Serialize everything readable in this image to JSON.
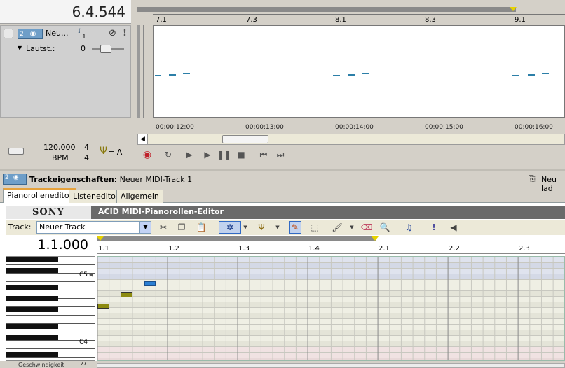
{
  "timeline": {
    "position": "6.4.544",
    "ruler_ticks": [
      "7.1",
      "7.3",
      "8.1",
      "8.3",
      "9.1"
    ],
    "time_labels": [
      "00:00:12:00",
      "00:00:13:00",
      "00:00:14:00",
      "00:00:15:00",
      "00:00:16:00"
    ]
  },
  "track": {
    "number": "2",
    "name": "Neu...",
    "midi_channel": "1",
    "volume_label": "Lautst.:",
    "volume_value": "0"
  },
  "tempo": {
    "bpm_value": "120,000",
    "bpm_label": "BPM",
    "time_sig_top": "4",
    "time_sig_bottom": "4",
    "key_label": "= A"
  },
  "properties": {
    "title_bold": "Trackeigenschaften:",
    "title_track": "Neuer MIDI-Track 1",
    "reload_label": "Neu lad"
  },
  "tabs": [
    {
      "label": "Pianorolleneditor",
      "active": true
    },
    {
      "label": "Listeneditor",
      "active": false
    },
    {
      "label": "Allgemein",
      "active": false
    }
  ],
  "editor": {
    "brand": "SONY",
    "title": "ACID MIDI-Pianorollen-Editor",
    "track_label": "Track:",
    "track_value": "Neuer Track",
    "position": "1.1.000",
    "ruler_ticks": [
      "1.1",
      "1.2",
      "1.3",
      "1.4",
      "2.1",
      "2.2",
      "2.3"
    ],
    "key_labels": [
      "C5",
      "C4"
    ],
    "bottom_label": "Geschwindigkeit",
    "bottom_value": "127"
  },
  "colors": {
    "note_selected": "#2a7fd4",
    "note_olive": "#8c8a10",
    "accent_tab": "#e6a23c"
  }
}
